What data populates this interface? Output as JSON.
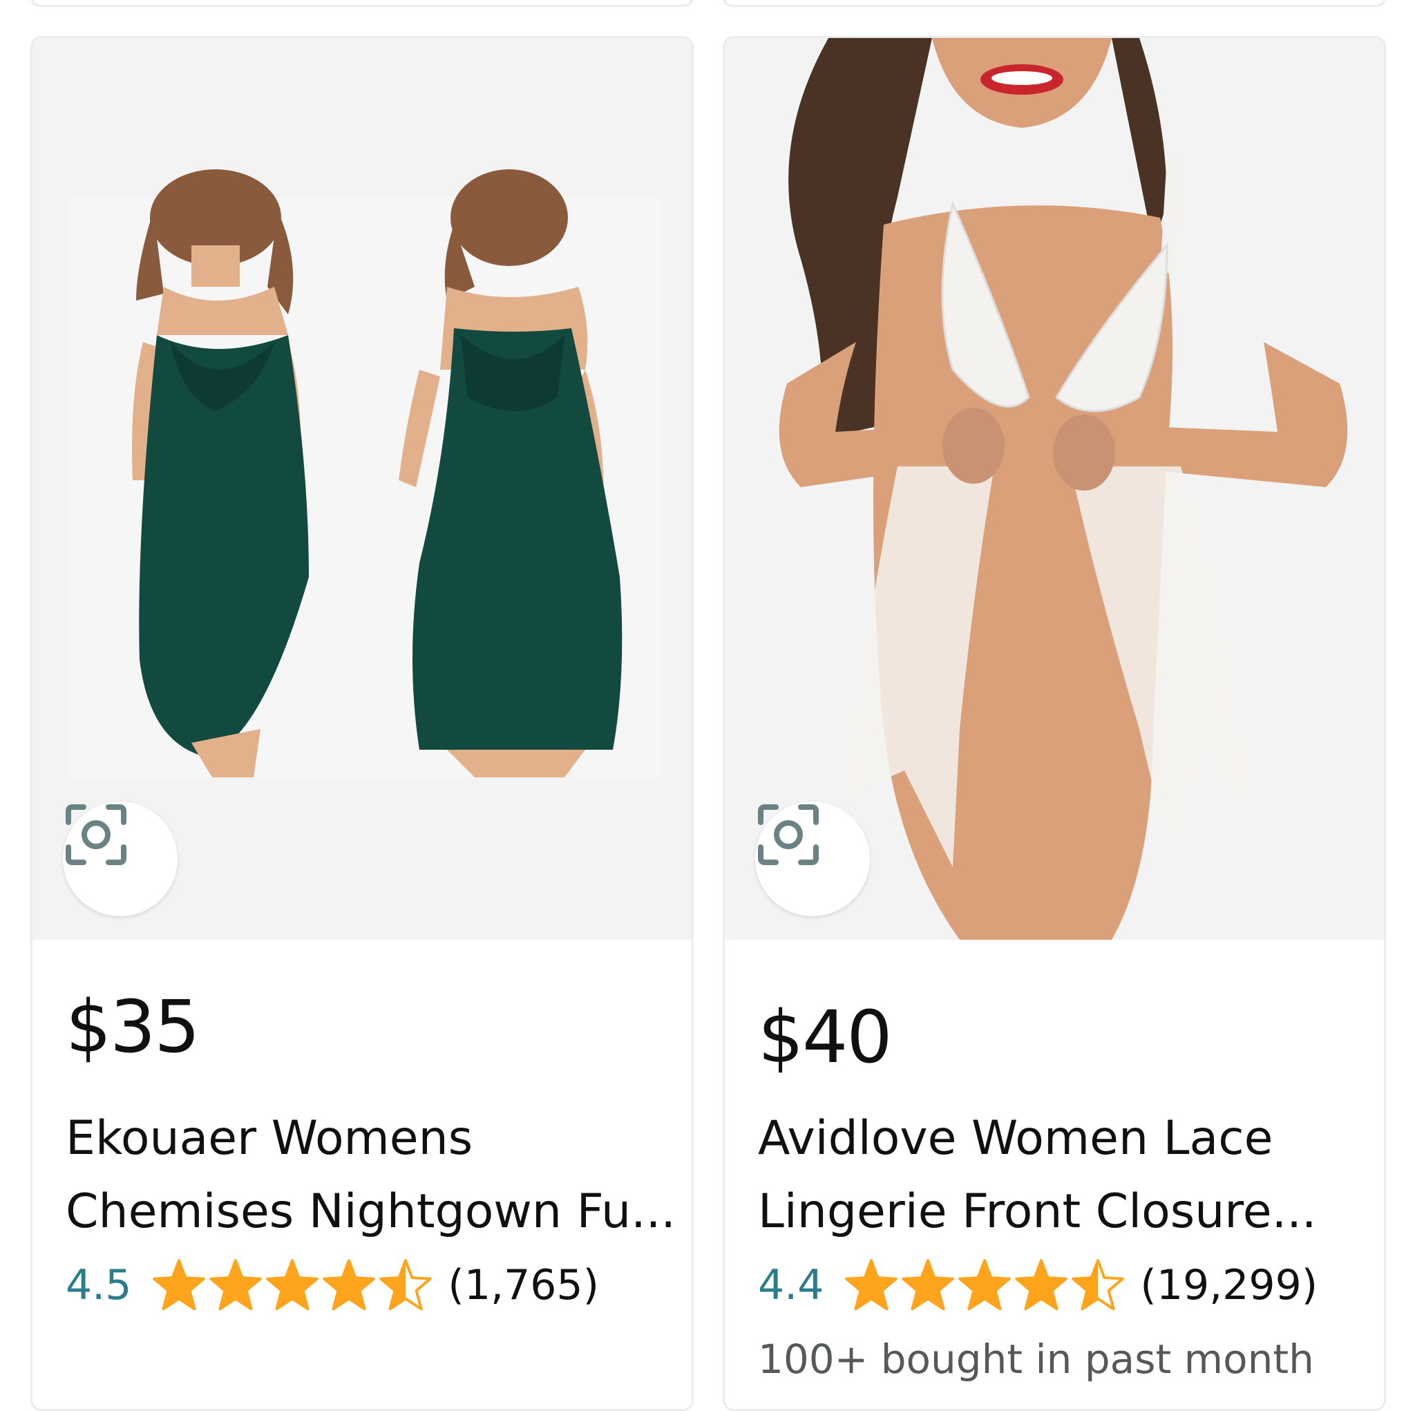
{
  "products": [
    {
      "price": "$35",
      "title_line1": "Ekouaer Womens",
      "title_line2": "Chemises Nightgown Fu...",
      "rating": "4.5",
      "rating_value": 4.5,
      "review_count": "(1,765)",
      "image_alt": "green nightgown chemise front and back",
      "dress_color": "#124a40"
    },
    {
      "price": "$40",
      "title_line1": "Avidlove Women Lace",
      "title_line2": "Lingerie Front Closure...",
      "rating": "4.4",
      "rating_value": 4.4,
      "review_count": "(19,299)",
      "bought_note": "100+ bought in past month",
      "image_alt": "white lace babydoll lingerie",
      "dress_color": "#f4f2ef"
    }
  ],
  "colors": {
    "star": "#ffa41c",
    "rating_text": "#2a7d8a",
    "price": "#0f1111"
  },
  "icons": {
    "lens": "visual-search-lens-icon",
    "star": "star-icon"
  }
}
